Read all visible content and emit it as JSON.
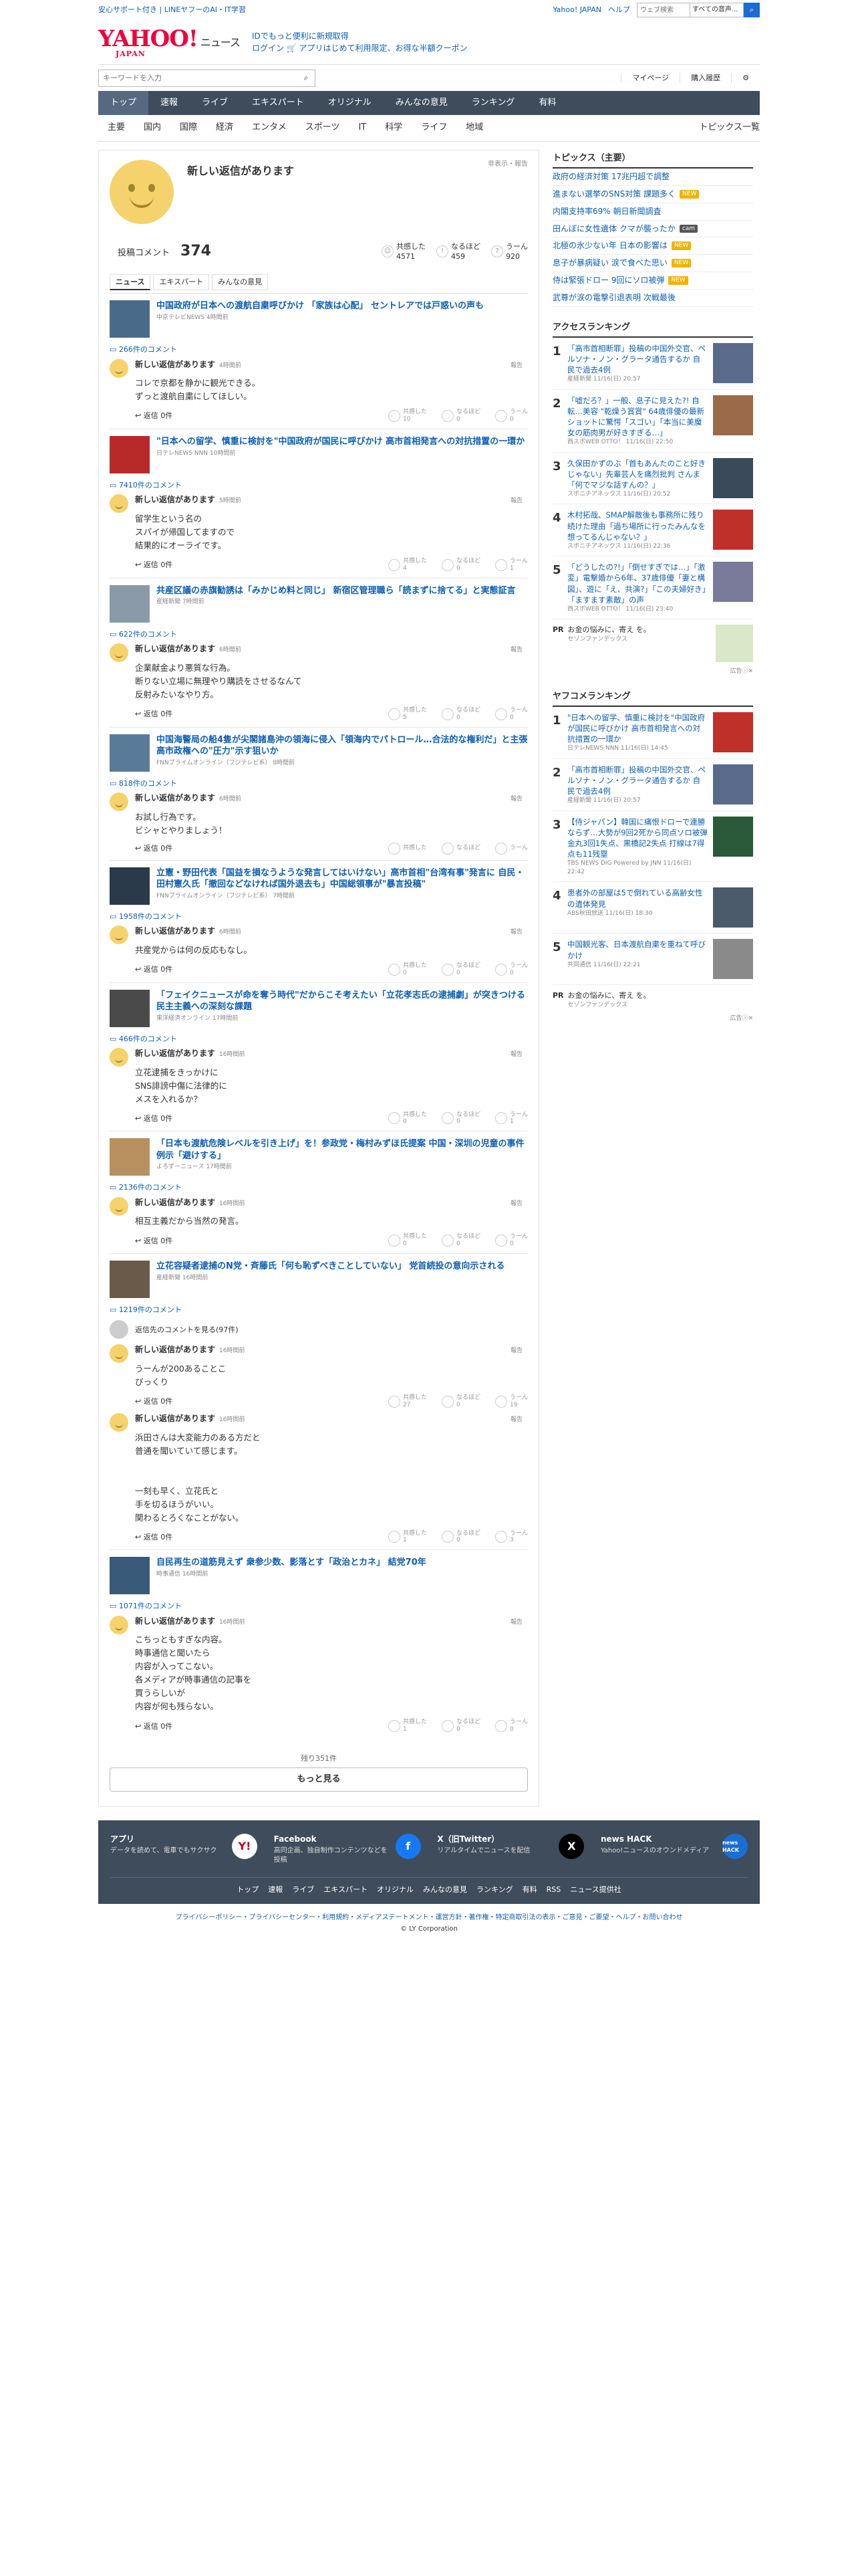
{
  "topbar": {
    "left": "安心サポート付き | LINEヤフーのAI・IT学習",
    "links": [
      "Yahoo! JAPAN",
      "ヘルプ"
    ],
    "search_placeholder": "ウェブ検索",
    "search_scope": "すべての音声..."
  },
  "header": {
    "logo": "YAHOO!",
    "logo_sub": "JAPAN",
    "logo_news": "ニュース",
    "promo_line1": "IDでもっと便利に新規取得",
    "promo_line2": "ログイン 🛒 アプリはじめて利用限定、お得な半額クーポン"
  },
  "bar2": {
    "keyword_placeholder": "キーワードを入力",
    "mypage": "マイページ",
    "history": "購入履歴"
  },
  "gnav": [
    "トップ",
    "速報",
    "ライブ",
    "エキスパート",
    "オリジナル",
    "みんなの意見",
    "ランキング",
    "有料"
  ],
  "snav": {
    "items": [
      "主要",
      "国内",
      "国際",
      "経済",
      "エンタメ",
      "スポーツ",
      "IT",
      "科学",
      "ライフ",
      "地域"
    ],
    "right": "トピックス一覧"
  },
  "profile": {
    "name": "新しい返信があります",
    "hide": "非表示・報告",
    "comment_label": "投稿コメント",
    "comment_count": "374",
    "reactions": [
      {
        "label": "共感した",
        "count": "4571"
      },
      {
        "label": "なるほど",
        "count": "459"
      },
      {
        "label": "うーん",
        "count": "920"
      }
    ]
  },
  "tabs": [
    "ニュース",
    "エキスパート",
    "みんなの意見"
  ],
  "reply_label": "返信 0件",
  "report_label": "報告",
  "vote_labels": [
    "共感した",
    "なるほど",
    "うーん"
  ],
  "items": [
    {
      "title": "中国政府が日本への渡航自粛呼びかけ 「家族は心配」 セントレアでは戸惑いの声も",
      "source": "中京テレビNEWS 4時間前",
      "count": "266件のコメント",
      "author": "新しい返信があります",
      "time": "4時間前",
      "text": "コレで京都を静かに観光できる。\nずっと渡航自粛にしてほしい。",
      "votes": [
        "10",
        "0",
        "0"
      ]
    },
    {
      "title": "\"日本への留学、慎重に検討を\"中国政府が国民に呼びかけ 高市首相発言への対抗措置の一環か",
      "source": "日テレNEWS NNN 10時間前",
      "count": "7410件のコメント",
      "author": "新しい返信があります",
      "time": "5時間前",
      "text": "留学生という名の\nスパイが帰国してますので\n結果的にオーライです。",
      "votes": [
        "4",
        "0",
        "1"
      ]
    },
    {
      "title": "共産区議の赤旗勧誘は「みかじめ料と同じ」 新宿区管理職ら「読まずに捨てる」と実態証言",
      "source": "産経新聞 7時間前",
      "count": "622件のコメント",
      "author": "新しい返信があります",
      "time": "6時間前",
      "text": "企業献金より悪質な行為。\n断りない立場に無理やり購読をさせるなんて\n反射みたいなやり方。",
      "votes": [
        "5",
        "0",
        "0"
      ]
    },
    {
      "title": "中国海警局の船4隻が尖閣諸島沖の領海に侵入「領海内でパトロール…合法的な権利だ」と主張 高市政権への\"圧力\"示す狙いか",
      "source": "FNNプライムオンライン（フジテレビ系） 8時間前",
      "count": "818件のコメント",
      "author": "新しい返信があります",
      "time": "6時間前",
      "text": "お試し行為です。\nビシャとやりましょう！",
      "votes": [
        "",
        "",
        ""
      ]
    },
    {
      "title": "立憲・野田代表「国益を損なうような発言してはいけない」高市首相\"台湾有事\"発言に 自民・田村憲久氏「撤回などなければ国外退去も」中国総領事が\"暴言投稿\"",
      "source": "FNNプライムオンライン（フジテレビ系） 7時間前",
      "count": "1958件のコメント",
      "author": "新しい返信があります",
      "time": "6時間前",
      "text": "共産党からは何の反応もなし。",
      "votes": [
        "0",
        "0",
        "0"
      ]
    },
    {
      "title": "「フェイクニュースが命を奪う時代\"だからこそ考えたい「立花孝志氏の逮捕劇」が突きつける民主主義への深刻な課題",
      "source": "東洋経済オンライン 17時間前",
      "count": "466件のコメント",
      "author": "新しい返信があります",
      "time": "16時間前",
      "text": "立花逮捕をきっかけに\nSNS誹謗中傷に法律的に\nメスを入れるか？",
      "votes": [
        "0",
        "0",
        "1"
      ]
    },
    {
      "title": "「日本も渡航危険レベルを引き上げ」を！参政党・梅村みずほ氏提案 中国・深圳の児童の事件例示「避けする」",
      "source": "よろずーニュース 17時間前",
      "count": "2136件のコメント",
      "author": "新しい返信があります",
      "time": "16時間前",
      "text": "相互主義だから当然の発言。",
      "votes": [
        "0",
        "0",
        "0"
      ]
    },
    {
      "title": "立花容疑者逮捕のN党・斉藤氏「何も恥ずべきことしていない」 党首続投の意向示される",
      "source": "産経新聞 16時間前",
      "count": "1219件のコメント",
      "more": "返信先のコメントを見る(97件)",
      "replies": [
        {
          "author": "新しい返信があります",
          "time": "16時間前",
          "text": "うーんが200あることこ\nびっくり",
          "votes": [
            "27",
            "0",
            "19"
          ]
        },
        {
          "author": "新しい返信があります",
          "time": "16時間前",
          "text": "浜田さんは大変能力のある方だと\n普通を聞いていて感じます。\n\n\n一刻も早く、立花氏と\n手を切るほうがいい。\n関わるとろくなことがない。",
          "votes": [
            "1",
            "0",
            "3"
          ]
        }
      ]
    },
    {
      "title": "自民再生の道筋見えず 衆参少数、影落とす「政治とカネ」 結党70年",
      "source": "時事通信 16時間前",
      "count": "1071件のコメント",
      "author": "新しい返信があります",
      "time": "16時間前",
      "text": "こちっともすぎな内容。\n時事通信と聞いたら\n内容が入ってこない。\n各メディアが時事通信の記事を\n買うらしいが\n内容が何も残らない。",
      "votes": [
        "1",
        "0",
        "0"
      ]
    }
  ],
  "rest": "残り351件",
  "more": "もっと見る",
  "topics": {
    "heading": "トピックス（主要）",
    "items": [
      {
        "text": "政府の経済対策 17兆円超で調整",
        "badge": ""
      },
      {
        "text": "進まない選挙のSNS対策 課題多く",
        "badge": "NEW"
      },
      {
        "text": "内閣支持率69% 朝日新聞調査",
        "badge": ""
      },
      {
        "text": "田んぼに女性遺体 クマが襲ったか",
        "badge": "cam"
      },
      {
        "text": "北極の氷少ない年 日本の影響は",
        "badge": "NEW"
      },
      {
        "text": "息子が暴病疑い 涙で食べた思い",
        "badge": "NEW"
      },
      {
        "text": "侍は緊張ドロー 9回にソロ被弾",
        "badge": "NEW"
      },
      {
        "text": "武尊が涙の電撃引退表明 次戦最後",
        "badge": ""
      }
    ]
  },
  "access": {
    "heading": "アクセスランキング",
    "items": [
      {
        "no": "1",
        "text": "「高市首相断罪」投稿の中国外交官、ペルソナ・ノン・グラータ通告するか 自民で過去4例",
        "src": "産経新聞 11/16(日) 20:57"
      },
      {
        "no": "2",
        "text": "「嘘だろ？」一般、息子に見えた?! 自転…美容 \"乾燥う賞賞\" 64歳俳優の最新ショットに驚愕「スゴい」「本当に美魔女の筋肉男が好きすぎる…」",
        "src": "西スポWEB OTTO！ 11/16(日) 22:50"
      },
      {
        "no": "3",
        "text": "久保田かずのぶ「首もあんたのこと好きじゃない」先輩芸人を痛烈批判 さんま「何でマジな話すんの？」",
        "src": "スポニチアネックス 11/16(日) 20:52"
      },
      {
        "no": "4",
        "text": "木村拓哉、SMAP解散後も事務所に残り続けた理由「過ち場所に行ったみんなを想ってるんじゃない？」",
        "src": "スポニチアネックス 11/16(日) 22:36"
      },
      {
        "no": "5",
        "text": "「どうしたの?!」「倒せすぎでは…」「激変」電撃婚から6年、37歳俳優「妻と構図」、遊に「え、共演?」「この夫婦好き」「ますます素敵」の声",
        "src": "西スポWEB OTTO！ 11/16(日) 23:40"
      }
    ]
  },
  "ad": {
    "label": "PR",
    "title": "お金の悩みに、寄え を。",
    "sponsor": "セゾンファンデックス",
    "note": "広告ⓘ✕"
  },
  "yafoo": {
    "heading": "ヤフコメランキング",
    "items": [
      {
        "no": "1",
        "text": "\"日本への留学、慎重に検討を\"中国政府が国民に呼びかけ 高市首相発言への対抗措置の一環か",
        "src": "日テレNEWS NNN 11/16(日) 14:45"
      },
      {
        "no": "2",
        "text": "「高市首相断罪」投稿の中国外交官、ペルソナ・ノン・グラータ通告するか 自民で過去4例",
        "src": "産経新聞 11/16(日) 20:57"
      },
      {
        "no": "3",
        "text": "【侍ジャパン】韓国に痛恨ドローで連勝ならず…大勢が9回2死から同点ソロ被弾 金丸3回1失点、黒橋記2失点 打線は7得点も11残塁",
        "src": "TBS NEWS DIG Powered by JNN 11/16(日) 22:42"
      },
      {
        "no": "4",
        "text": "患者外の部屋は5で倒れている高齢女性の遺体発見",
        "src": "ABS秋田放送 11/16(日) 18:30"
      },
      {
        "no": "5",
        "text": "中国観光客、日本渡航自粛を重ねて呼びかけ",
        "src": "共同通信 11/16(日) 22:21"
      }
    ]
  },
  "ad2": {
    "label": "PR",
    "title": "お金の悩みに、寄え を。",
    "sponsor": "セゾンファンデックス",
    "note": "広告ⓘ✕"
  },
  "footer": {
    "cols": [
      {
        "title": "アプリ",
        "desc": "データを読めて、電車でもサクサク",
        "icon": "Y!"
      },
      {
        "title": "Facebook",
        "desc": "高同企画、独自制作コンテンツなどを投稿",
        "icon": "f"
      },
      {
        "title": "X（旧Twitter）",
        "desc": "リアルタイムでニュースを配信",
        "icon": "X"
      },
      {
        "title": "news HACK",
        "desc": "Yahoo!ニュースのオウンドメディア",
        "icon": "news HACK"
      }
    ],
    "links": [
      "トップ",
      "速報",
      "ライブ",
      "エキスパート",
      "オリジナル",
      "みんなの意見",
      "ランキング",
      "有料",
      "RSS",
      "ニュース提供社"
    ],
    "legal": "プライバシーポリシー・プライバシーセンター・利用規約・メディアステートメント・運営方針・著作権・特定商取引法の表示・ご意見・ご要望・ヘルプ・お問い合わせ",
    "copy": "© LY Corporation"
  }
}
